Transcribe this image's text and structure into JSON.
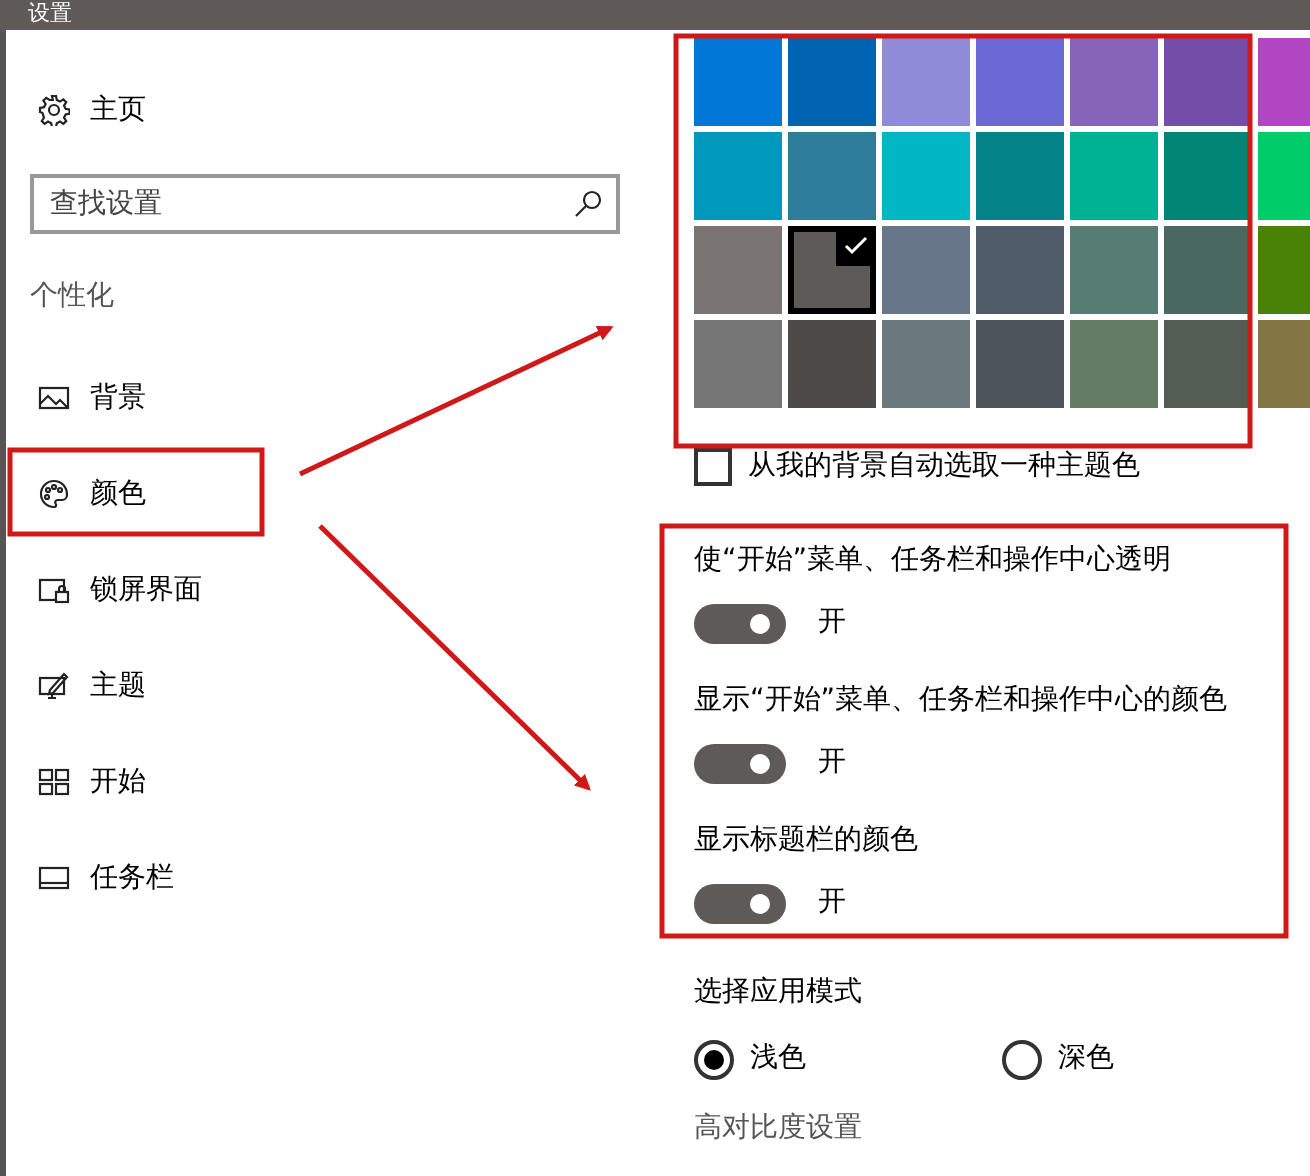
{
  "window": {
    "title": "设置"
  },
  "sidebar": {
    "home": "主页",
    "search": {
      "placeholder": "查找设置"
    },
    "section": "个性化",
    "items": [
      {
        "kind": "picture",
        "label": "背景"
      },
      {
        "kind": "palette",
        "label": "颜色"
      },
      {
        "kind": "lockscreen",
        "label": "锁屏界面"
      },
      {
        "kind": "theme",
        "label": "主题"
      },
      {
        "kind": "start",
        "label": "开始"
      },
      {
        "kind": "taskbar",
        "label": "任务栏"
      }
    ]
  },
  "accent_colors": [
    [
      {
        "color": "#0078d7",
        "selected": false
      },
      {
        "color": "#0063b1",
        "selected": false
      },
      {
        "color": "#8e8cd8",
        "selected": false
      },
      {
        "color": "#6b69d6",
        "selected": false
      },
      {
        "color": "#8764b8",
        "selected": false
      },
      {
        "color": "#744da9",
        "selected": false
      },
      {
        "color": "#b146c2",
        "selected": false
      }
    ],
    [
      {
        "color": "#0099bc",
        "selected": false
      },
      {
        "color": "#2d7d9a",
        "selected": false
      },
      {
        "color": "#00b7c3",
        "selected": false
      },
      {
        "color": "#038387",
        "selected": false
      },
      {
        "color": "#00b294",
        "selected": false
      },
      {
        "color": "#018574",
        "selected": false
      },
      {
        "color": "#00cc6a",
        "selected": false
      }
    ],
    [
      {
        "color": "#7a7574",
        "selected": false
      },
      {
        "color": "#5d5a58",
        "selected": true
      },
      {
        "color": "#68768a",
        "selected": false
      },
      {
        "color": "#515c6b",
        "selected": false
      },
      {
        "color": "#567c73",
        "selected": false
      },
      {
        "color": "#486860",
        "selected": false
      },
      {
        "color": "#498205",
        "selected": false
      }
    ],
    [
      {
        "color": "#767676",
        "selected": false
      },
      {
        "color": "#4c4a48",
        "selected": false
      },
      {
        "color": "#69797e",
        "selected": false
      },
      {
        "color": "#4a5459",
        "selected": false
      },
      {
        "color": "#647c64",
        "selected": false
      },
      {
        "color": "#525e54",
        "selected": false
      },
      {
        "color": "#847545",
        "selected": false
      }
    ]
  ],
  "auto_pick": {
    "label": "从我的背景自动选取一种主题色",
    "checked": false
  },
  "toggles": [
    {
      "label": "使“开始”菜单、任务栏和操作中心透明",
      "on": true,
      "state": "开"
    },
    {
      "label": "显示“开始”菜单、任务栏和操作中心的颜色",
      "on": true,
      "state": "开"
    },
    {
      "label": "显示标题栏的颜色",
      "on": true,
      "state": "开"
    }
  ],
  "app_mode": {
    "label": "选择应用模式",
    "options": [
      {
        "label": "浅色",
        "selected": true
      },
      {
        "label": "深色",
        "selected": false
      }
    ]
  },
  "high_contrast_link": "高对比度设置"
}
